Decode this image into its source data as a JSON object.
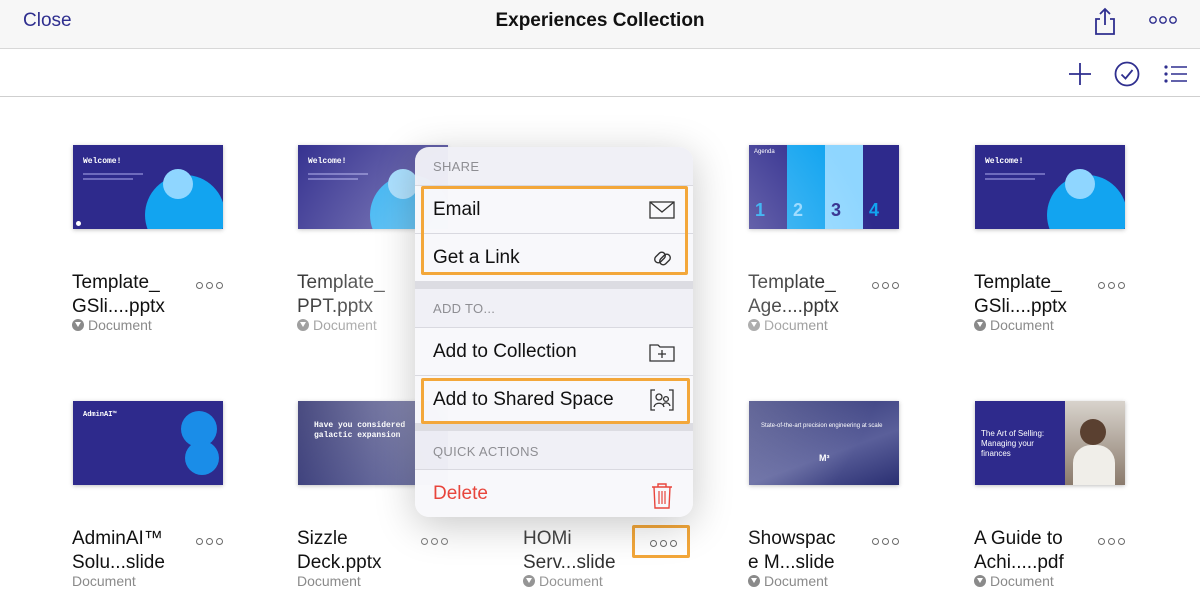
{
  "nav": {
    "close": "Close",
    "title": "Experiences Collection"
  },
  "toolbar": {
    "add": "plus-icon",
    "select": "checkmark-circle-icon",
    "view": "list-icon"
  },
  "items": [
    {
      "name": "Template_\nGSli....pptx",
      "sub": "Document",
      "thumb_title": "Welcome!",
      "downloaded": true
    },
    {
      "name": "Template_\nPPT.pptx",
      "sub": "Document",
      "thumb_title": "Welcome!",
      "downloaded": true
    },
    {
      "name": "",
      "sub": "",
      "thumb_title": "",
      "downloaded": false
    },
    {
      "name": "Template_\nAge....pptx",
      "sub": "Document",
      "thumb_title": "Agenda",
      "downloaded": true
    },
    {
      "name": "Template_\nGSli....pptx",
      "sub": "Document",
      "thumb_title": "Welcome!",
      "downloaded": true
    },
    {
      "name": "AdminAI™\nSolu...slide",
      "sub": "Document",
      "thumb_title": "AdminAI™",
      "downloaded": false
    },
    {
      "name": "Sizzle\nDeck.pptx",
      "sub": "Document",
      "thumb_title": "Have you considered\ngalactic expansion",
      "downloaded": false
    },
    {
      "name": "HOMi\nServ...slide",
      "sub": "Document",
      "thumb_title": "",
      "downloaded": true
    },
    {
      "name": "Showspac\ne M...slide",
      "sub": "Document",
      "thumb_title": "State-of-the-art precision engineering at scale",
      "downloaded": true
    },
    {
      "name": "A Guide to\nAchi.....pdf",
      "sub": "Document",
      "thumb_title": "The Art of Selling: Managing your finances",
      "downloaded": true
    }
  ],
  "agenda_numbers": [
    "1",
    "2",
    "3",
    "4"
  ],
  "thumb_mark": "M³",
  "popover": {
    "share_header": "SHARE",
    "email": "Email",
    "get_link": "Get a Link",
    "add_header": "ADD TO...",
    "add_collection": "Add to Collection",
    "add_shared": "Add to Shared Space",
    "quick_header": "QUICK ACTIONS",
    "delete": "Delete"
  },
  "colors": {
    "accent": "#2f2f8f",
    "highlight": "#f3a73a",
    "delete": "#e8453c",
    "slide": "#2e2a8c"
  }
}
